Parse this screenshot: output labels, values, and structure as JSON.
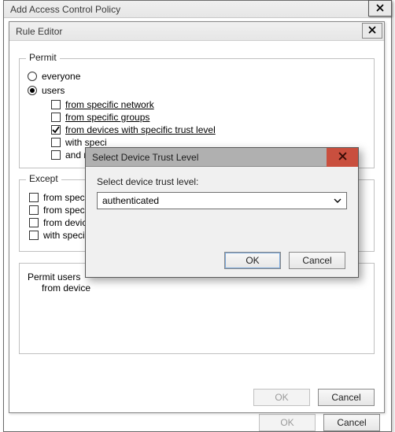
{
  "outer": {
    "title": "Add Access Control Policy",
    "ok": "OK",
    "cancel": "Cancel"
  },
  "rule": {
    "title": "Rule Editor",
    "ok": "OK",
    "cancel": "Cancel"
  },
  "permit": {
    "legend": "Permit",
    "everyone": "everyone",
    "users": "users",
    "check_network": "from specific network",
    "check_groups": "from specific groups",
    "check_trust": "from devices with specific trust level",
    "check_claims_partial": "with speci",
    "check_require_partial": "and req"
  },
  "except": {
    "legend": "Except",
    "c1": "from specifi",
    "c2": "from specifi",
    "c3": "from device",
    "c4": "with specifi"
  },
  "summary": {
    "line1": "Permit users",
    "line2_indent": "from device"
  },
  "modal": {
    "title": "Select Device Trust Level",
    "label": "Select device trust level:",
    "selected": "authenticated",
    "ok": "OK",
    "cancel": "Cancel"
  }
}
